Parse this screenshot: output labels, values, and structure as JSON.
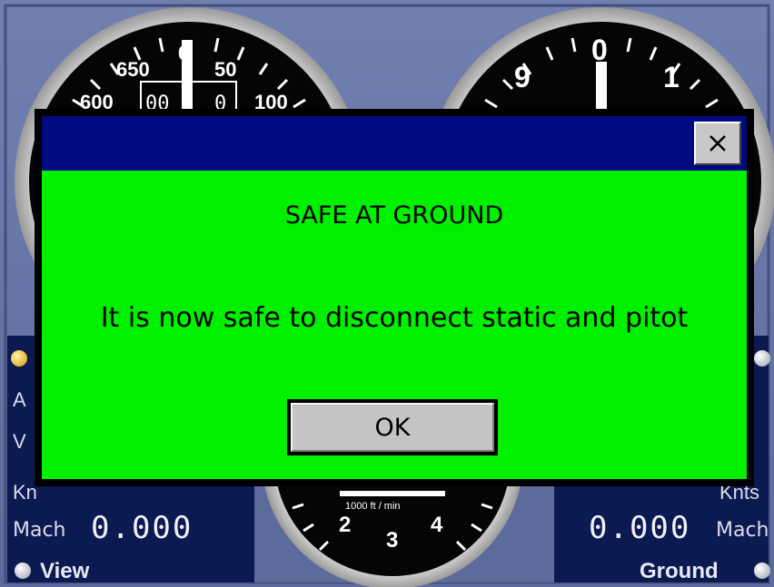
{
  "dialog": {
    "title": "SAFE AT GROUND",
    "message": "It is now safe to disconnect static and pitot",
    "ok_label": "OK"
  },
  "airspeed_gauge": {
    "ticks": [
      "650",
      "0",
      "50",
      "600",
      "100"
    ],
    "drum": "00",
    "drum2": "0"
  },
  "altimeter_gauge": {
    "ticks": [
      "9",
      "0",
      "1"
    ]
  },
  "vsi_gauge": {
    "unit": "1000 ft / min",
    "ticks": [
      "2",
      "3",
      "4"
    ]
  },
  "left_panel": {
    "frag_a": "A",
    "frag_v": "V",
    "knots_frag": "Kn",
    "mach_label": "Mach",
    "mach_value": "0.000",
    "view_label": "View"
  },
  "right_panel": {
    "knots_frag": "Knts",
    "mach_value": "0.000",
    "mach_label": "Mach",
    "ground_label": "Ground"
  },
  "colors": {
    "dialog_bg": "#00f000",
    "titlebar": "#000a80",
    "panel": "#0c1a52"
  }
}
